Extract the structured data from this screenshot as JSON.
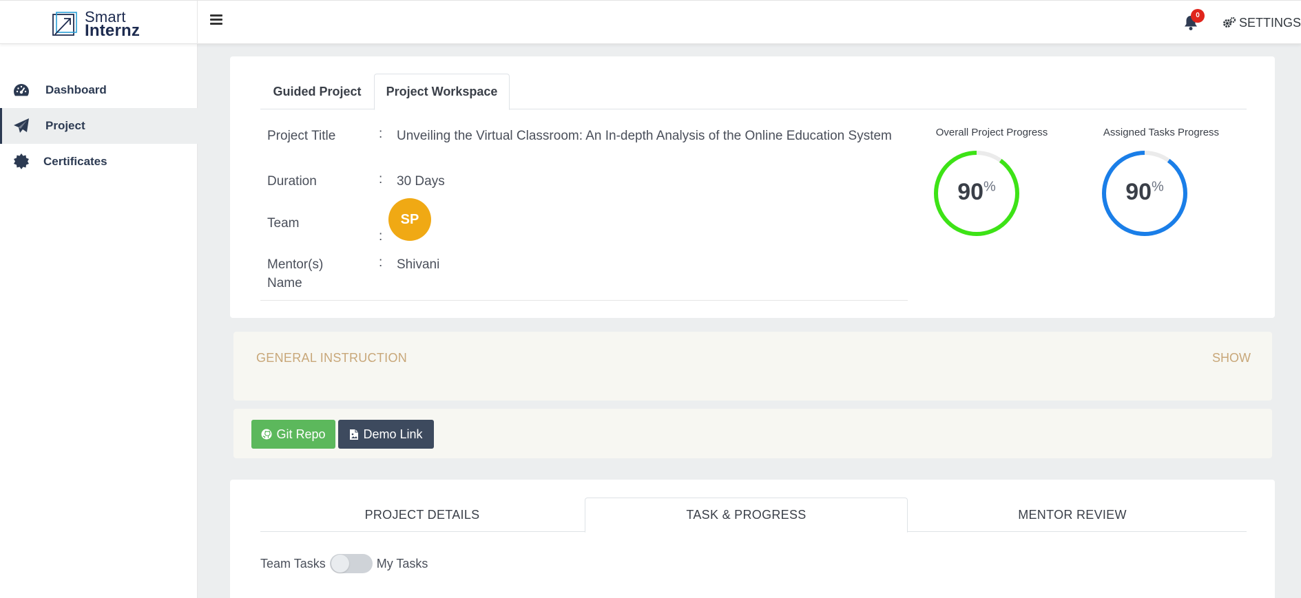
{
  "brand": {
    "name_line1": "Smart",
    "name_line2": "Internz"
  },
  "header": {
    "notification_count": "0",
    "settings_label": "SETTINGS"
  },
  "sidebar": {
    "items": [
      {
        "label": "Dashboard",
        "icon": "gauge-icon"
      },
      {
        "label": "Project",
        "icon": "paper-plane-icon",
        "active": true
      },
      {
        "label": "Certificates",
        "icon": "certificate-icon"
      }
    ]
  },
  "project_tabs": [
    {
      "label": "Guided Project",
      "active": false
    },
    {
      "label": "Project Workspace",
      "active": true
    }
  ],
  "project_info": {
    "title_label": "Project Title",
    "title_value": "Unveiling the Virtual Classroom: An In-depth Analysis of the Online Education System",
    "duration_label": "Duration",
    "duration_value": "30 Days",
    "team_label": "Team",
    "team_avatar": "SP",
    "mentor_label": "Mentor(s) Name",
    "mentor_value": "Shivani",
    "colon": ":"
  },
  "progress": {
    "overall": {
      "title": "Overall Project Progress",
      "value": "90",
      "unit": "%",
      "percent": 90,
      "color": "#3de316"
    },
    "assigned": {
      "title": "Assigned Tasks Progress",
      "value": "90",
      "unit": "%",
      "percent": 90,
      "color": "#1a7ee8"
    }
  },
  "general_instruction": {
    "title": "GENERAL INSTRUCTION",
    "toggle_label": "SHOW"
  },
  "links": {
    "git_label": "Git Repo",
    "demo_label": "Demo Link"
  },
  "detail_tabs": [
    {
      "label": "PROJECT DETAILS",
      "active": false
    },
    {
      "label": "TASK & PROGRESS",
      "active": true
    },
    {
      "label": "MENTOR REVIEW",
      "active": false
    }
  ],
  "task_toggle": {
    "left_label": "Team Tasks",
    "right_label": "My Tasks"
  },
  "colors": {
    "accent_dark": "#2c3a52",
    "git_green": "#5cb85c",
    "demo_dark": "#3d4a5e",
    "instruction_text": "#c8a779",
    "badge_red": "#e0251c",
    "avatar_orange": "#f0a914"
  }
}
